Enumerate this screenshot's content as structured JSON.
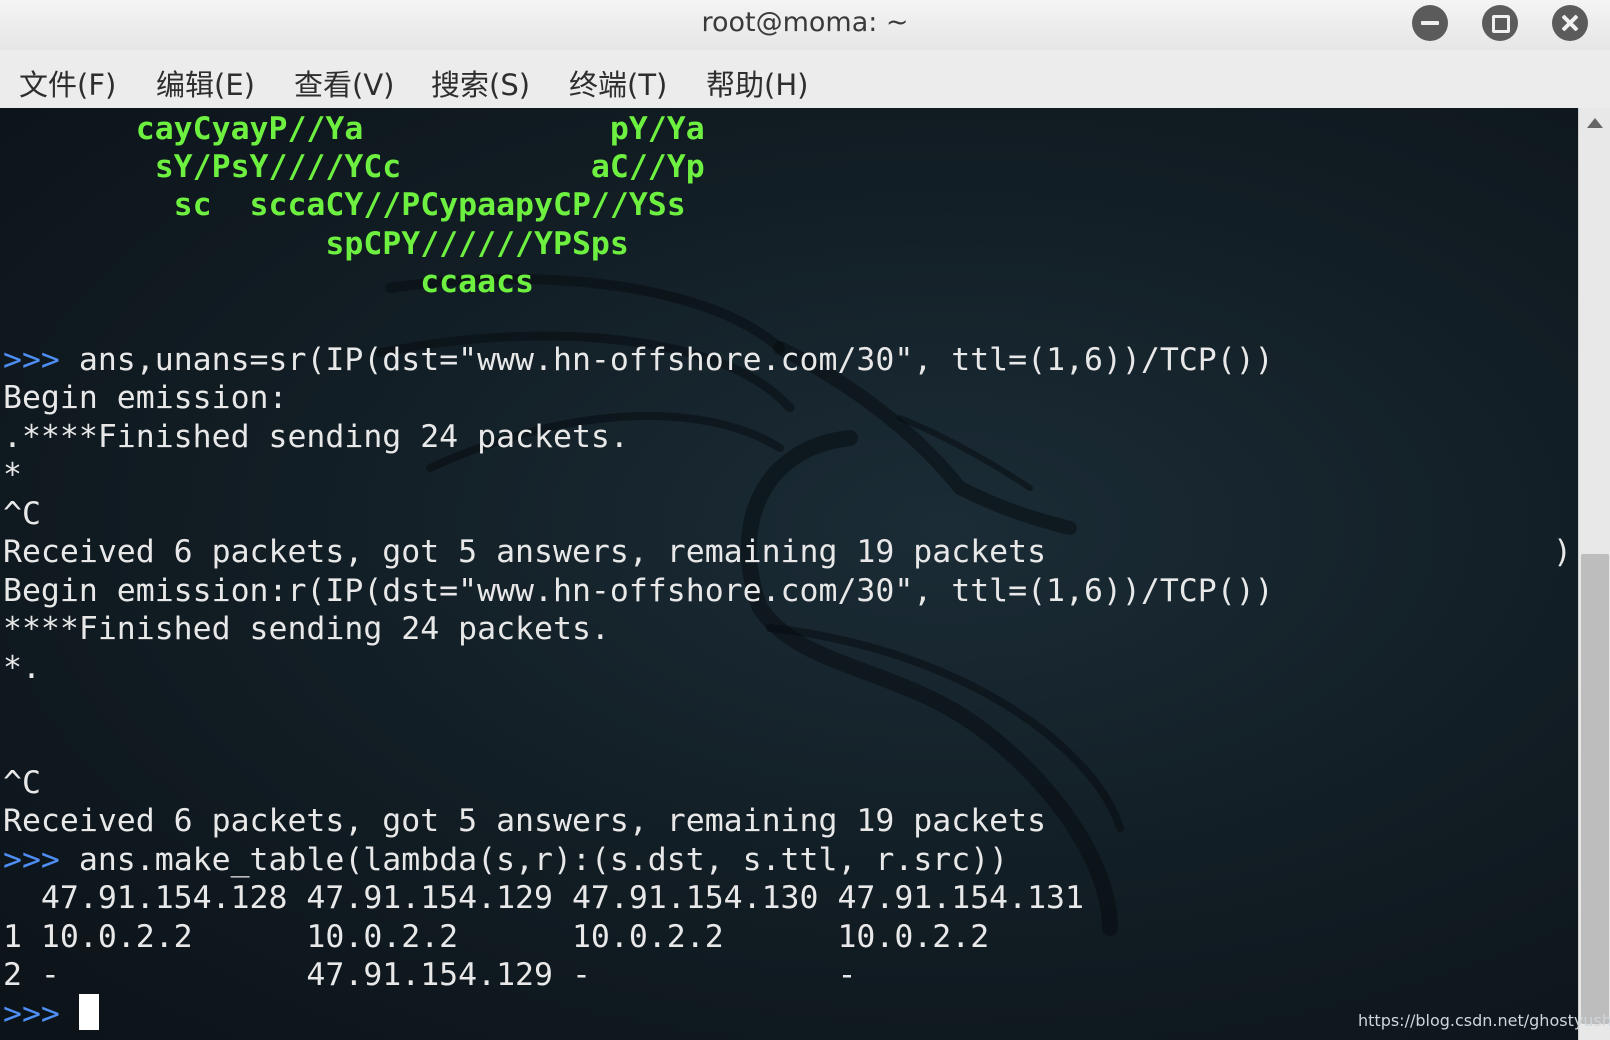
{
  "window": {
    "title": "root@moma: ~"
  },
  "menubar": {
    "items": [
      "文件(F)",
      "编辑(E)",
      "查看(V)",
      "搜索(S)",
      "终端(T)",
      "帮助(H)"
    ]
  },
  "terminal": {
    "ascii_art": [
      "       cayCyayP//Ya             pY/Ya",
      "        sY/PsY////YCc          aC//Yp",
      "         sc  sccaCY//PCypaapyCP//YSs",
      "                 spCPY//////YPSps",
      "                      ccaacs"
    ],
    "prompt": ">>>",
    "lines": [
      {
        "prompt": true,
        "text": " ans,unans=sr(IP(dst=\"www.hn-offshore.com/30\", ttl=(1,6))/TCP())"
      },
      {
        "prompt": false,
        "text": "Begin emission:"
      },
      {
        "prompt": false,
        "text": ".****Finished sending 24 packets."
      },
      {
        "prompt": false,
        "text": "*"
      },
      {
        "prompt": false,
        "text": "^C"
      },
      {
        "prompt": false,
        "text": "Received 6 packets, got 5 answers, remaining 19 packets"
      },
      {
        "prompt": false,
        "text": "Begin emission:r(IP(dst=\"www.hn-offshore.com/30\", ttl=(1,6))/TCP())"
      },
      {
        "prompt": false,
        "text": "****Finished sending 24 packets."
      },
      {
        "prompt": false,
        "text": "*."
      },
      {
        "prompt": false,
        "text": ""
      },
      {
        "prompt": false,
        "text": ""
      },
      {
        "prompt": false,
        "text": "^C"
      },
      {
        "prompt": false,
        "text": "Received 6 packets, got 5 answers, remaining 19 packets"
      },
      {
        "prompt": true,
        "text": " ans.make_table(lambda(s,r):(s.dst, s.ttl, r.src))"
      },
      {
        "prompt": false,
        "text": "  47.91.154.128 47.91.154.129 47.91.154.130 47.91.154.131"
      },
      {
        "prompt": false,
        "text": "1 10.0.2.2      10.0.2.2      10.0.2.2      10.0.2.2"
      },
      {
        "prompt": false,
        "text": "2 -             47.91.154.129 -             -"
      }
    ],
    "stray_char": ")"
  },
  "watermark": "https://blog.csdn.net/ghostyusheng",
  "colors": {
    "prompt": "#4f8ff5",
    "ascii_art": "#6ef040",
    "text": "#e8e8e8",
    "background": "#111c23"
  }
}
